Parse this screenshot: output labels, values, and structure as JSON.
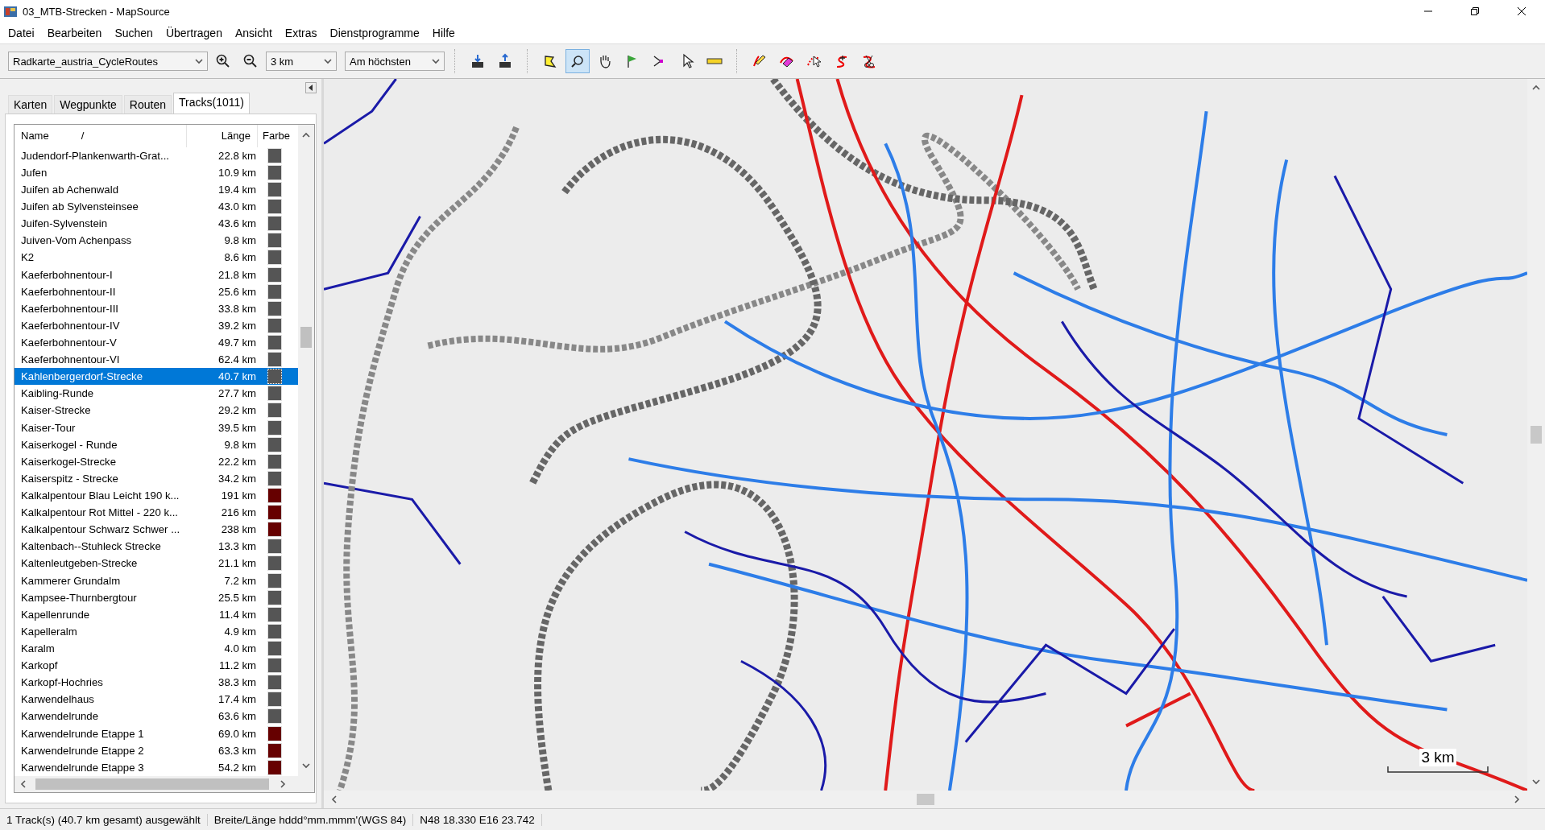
{
  "window": {
    "title": "03_MTB-Strecken - MapSource"
  },
  "menu": [
    "Datei",
    "Bearbeiten",
    "Suchen",
    "Übertragen",
    "Ansicht",
    "Extras",
    "Dienstprogramme",
    "Hilfe"
  ],
  "toolbar": {
    "map_product": "Radkarte_austria_CycleRoutes",
    "zoom_scale": "3 km",
    "detail": "Am höchsten",
    "tools": [
      {
        "kind": "receive",
        "selected": false
      },
      {
        "kind": "send",
        "selected": false
      },
      {
        "kind": "area",
        "selected": false
      },
      {
        "kind": "zoom",
        "selected": true
      },
      {
        "kind": "pan",
        "selected": false
      },
      {
        "kind": "waypoint",
        "selected": false
      },
      {
        "kind": "route",
        "selected": false
      },
      {
        "kind": "pointer",
        "selected": false
      },
      {
        "kind": "measure",
        "selected": false
      },
      {
        "kind": "draw",
        "selected": false
      },
      {
        "kind": "erase",
        "selected": false
      },
      {
        "kind": "pick",
        "selected": false
      },
      {
        "kind": "insert",
        "selected": false
      },
      {
        "kind": "divide",
        "selected": false
      }
    ]
  },
  "tabs": [
    {
      "label": "Karten",
      "selected": false
    },
    {
      "label": "Wegpunkte",
      "selected": false
    },
    {
      "label": "Routen",
      "selected": false
    },
    {
      "label": "Tracks(1011)",
      "selected": true
    }
  ],
  "table": {
    "columns": [
      "Name",
      "Länge",
      "Farbe"
    ],
    "sort_mark": "/",
    "rows": [
      {
        "name": "Judendorf-Plankenwarth-Grat...",
        "length": "22.8 km",
        "color": "#555555",
        "selected": false
      },
      {
        "name": "Jufen",
        "length": "10.9 km",
        "color": "#555555",
        "selected": false
      },
      {
        "name": "Juifen ab Achenwald",
        "length": "19.4 km",
        "color": "#555555",
        "selected": false
      },
      {
        "name": "Juifen ab Sylvensteinsee",
        "length": "43.0 km",
        "color": "#555555",
        "selected": false
      },
      {
        "name": "Juifen-Sylvenstein",
        "length": "43.6 km",
        "color": "#555555",
        "selected": false
      },
      {
        "name": "Juiven-Vom Achenpass",
        "length": "9.8 km",
        "color": "#555555",
        "selected": false
      },
      {
        "name": "K2",
        "length": "8.6 km",
        "color": "#555555",
        "selected": false
      },
      {
        "name": "Kaeferbohnentour-I",
        "length": "21.8 km",
        "color": "#555555",
        "selected": false
      },
      {
        "name": "Kaeferbohnentour-II",
        "length": "25.6 km",
        "color": "#555555",
        "selected": false
      },
      {
        "name": "Kaeferbohnentour-III",
        "length": "33.8 km",
        "color": "#555555",
        "selected": false
      },
      {
        "name": "Kaeferbohnentour-IV",
        "length": "39.2 km",
        "color": "#555555",
        "selected": false
      },
      {
        "name": "Kaeferbohnentour-V",
        "length": "49.7 km",
        "color": "#555555",
        "selected": false
      },
      {
        "name": "Kaeferbohnentour-VI",
        "length": "62.4 km",
        "color": "#555555",
        "selected": false
      },
      {
        "name": "Kahlenbergerdorf-Strecke",
        "length": "40.7 km",
        "color": "#555555",
        "selected": true
      },
      {
        "name": "Kaibling-Runde",
        "length": "27.7 km",
        "color": "#555555",
        "selected": false
      },
      {
        "name": "Kaiser-Strecke",
        "length": "29.2 km",
        "color": "#555555",
        "selected": false
      },
      {
        "name": "Kaiser-Tour",
        "length": "39.5 km",
        "color": "#555555",
        "selected": false
      },
      {
        "name": "Kaiserkogel - Runde",
        "length": "9.8 km",
        "color": "#555555",
        "selected": false
      },
      {
        "name": "Kaiserkogel-Strecke",
        "length": "22.2 km",
        "color": "#555555",
        "selected": false
      },
      {
        "name": "Kaiserspitz - Strecke",
        "length": "34.2 km",
        "color": "#555555",
        "selected": false
      },
      {
        "name": "Kalkalpentour Blau Leicht 190 k...",
        "length": "191 km",
        "color": "#660000",
        "selected": false
      },
      {
        "name": "Kalkalpentour Rot Mittel - 220 k...",
        "length": "216 km",
        "color": "#660000",
        "selected": false
      },
      {
        "name": "Kalkalpentour Schwarz Schwer ...",
        "length": "238 km",
        "color": "#660000",
        "selected": false
      },
      {
        "name": "Kaltenbach--Stuhleck Strecke",
        "length": "13.3 km",
        "color": "#555555",
        "selected": false
      },
      {
        "name": "Kaltenleutgeben-Strecke",
        "length": "21.1 km",
        "color": "#555555",
        "selected": false
      },
      {
        "name": "Kammerer Grundalm",
        "length": "7.2 km",
        "color": "#555555",
        "selected": false
      },
      {
        "name": "Kampsee-Thurnbergtour",
        "length": "25.5 km",
        "color": "#555555",
        "selected": false
      },
      {
        "name": "Kapellenrunde",
        "length": "11.4 km",
        "color": "#555555",
        "selected": false
      },
      {
        "name": "Kapelleralm",
        "length": "4.9 km",
        "color": "#555555",
        "selected": false
      },
      {
        "name": "Karalm",
        "length": "4.0 km",
        "color": "#555555",
        "selected": false
      },
      {
        "name": "Karkopf",
        "length": "11.2 km",
        "color": "#555555",
        "selected": false
      },
      {
        "name": "Karkopf-Hochries",
        "length": "38.3 km",
        "color": "#555555",
        "selected": false
      },
      {
        "name": "Karwendelhaus",
        "length": "17.4 km",
        "color": "#555555",
        "selected": false
      },
      {
        "name": "Karwendelrunde",
        "length": "63.6 km",
        "color": "#555555",
        "selected": false
      },
      {
        "name": "Karwendelrunde Etappe 1",
        "length": "69.0 km",
        "color": "#660000",
        "selected": false
      },
      {
        "name": "Karwendelrunde Etappe 2",
        "length": "63.3 km",
        "color": "#660000",
        "selected": false
      },
      {
        "name": "Karwendelrunde Etappe 3",
        "length": "54.2 km",
        "color": "#660000",
        "selected": false
      }
    ]
  },
  "map": {
    "scale_label": "3 km"
  },
  "status_bar": [
    "1 Track(s) (40.7 km gesamt) ausgewählt",
    "Breite/Länge hddd°mm.mmm'(WGS 84)",
    "N48 18.330 E16 23.742"
  ]
}
